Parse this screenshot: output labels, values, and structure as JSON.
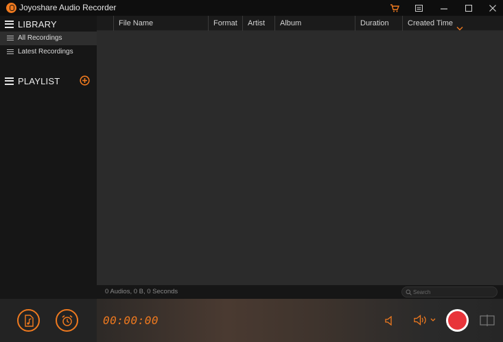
{
  "window": {
    "title": "Joyoshare Audio Recorder"
  },
  "sidebar": {
    "library_label": "LIBRARY",
    "items": [
      {
        "label": "All Recordings",
        "selected": true
      },
      {
        "label": "Latest Recordings",
        "selected": false
      }
    ],
    "playlist_label": "PLAYLIST"
  },
  "table": {
    "columns": [
      "File Name",
      "Format",
      "Artist",
      "Album",
      "Duration",
      "Created Time"
    ],
    "sort_column": "Created Time",
    "rows": []
  },
  "status": {
    "summary": "0 Audios, 0 B, 0 Seconds",
    "search_placeholder": "Search"
  },
  "controls": {
    "timer": "00:00:00"
  },
  "colors": {
    "accent": "#f07a1f",
    "record": "#e8343a",
    "background": "#2b2b2b"
  }
}
